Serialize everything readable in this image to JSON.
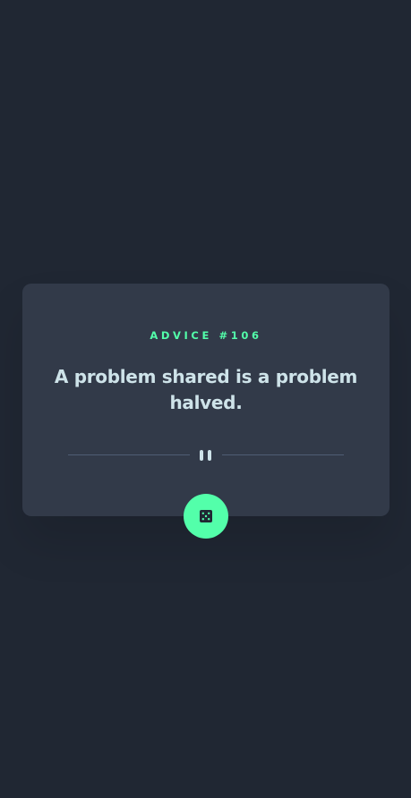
{
  "advice": {
    "id_label": "ADVICE #106",
    "text": "A problem shared is a problem halved."
  },
  "icons": {
    "divider": "pause-icon",
    "button": "dice-icon"
  },
  "colors": {
    "background": "#202733",
    "card": "#323a49",
    "accent": "#53ffaa",
    "text": "#cee3e9",
    "divider": "#4f5d74"
  }
}
